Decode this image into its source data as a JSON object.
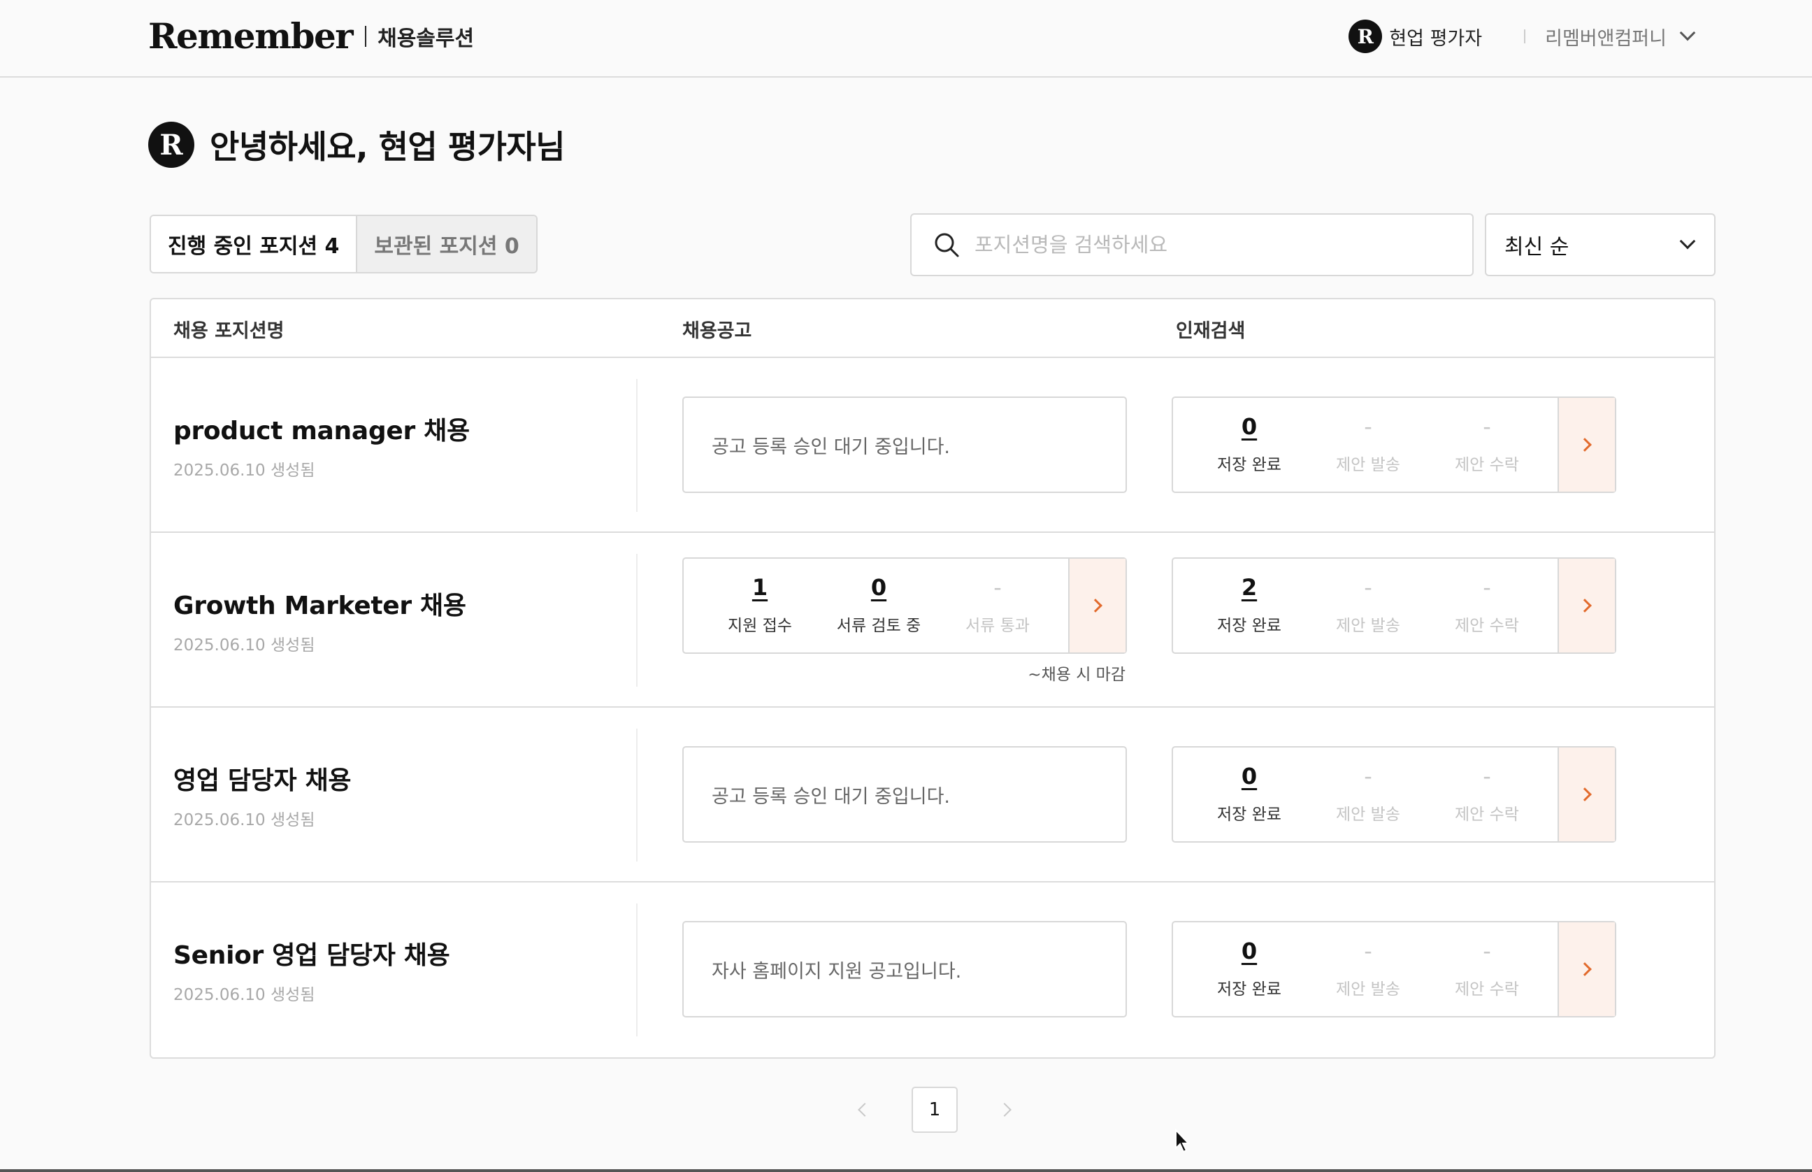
{
  "header": {
    "logo": "Remember",
    "product": "채용솔루션",
    "user_badge": "R",
    "user_name": "현업 평가자",
    "company": "리멤버앤컴퍼니"
  },
  "greeting": {
    "badge": "R",
    "text": "안녕하세요, 현업 평가자님"
  },
  "tabs": [
    {
      "label": "진행 중인 포지션 4",
      "active": true
    },
    {
      "label": "보관된 포지션 0",
      "active": false
    }
  ],
  "search": {
    "placeholder": "포지션명을 검색하세요"
  },
  "sort": {
    "selected": "최신 순"
  },
  "table": {
    "columns": [
      "채용 포지션명",
      "채용공고",
      "인재검색"
    ],
    "rows": [
      {
        "name": "product manager 채용",
        "created": "2025.06.10 생성됨",
        "posting_message": "공고 등록 승인 대기 중입니다.",
        "talent": [
          {
            "value": "0",
            "label": "저장 완료"
          },
          {
            "value": "-",
            "label": "제안 발송"
          },
          {
            "value": "-",
            "label": "제안 수락"
          }
        ]
      },
      {
        "name": "Growth Marketer 채용",
        "created": "2025.06.10 생성됨",
        "posting": [
          {
            "value": "1",
            "label": "지원 접수"
          },
          {
            "value": "0",
            "label": "서류 검토 중"
          },
          {
            "value": "-",
            "label": "서류 통과"
          }
        ],
        "deadline": "~채용 시 마감",
        "talent": [
          {
            "value": "2",
            "label": "저장 완료"
          },
          {
            "value": "-",
            "label": "제안 발송"
          },
          {
            "value": "-",
            "label": "제안 수락"
          }
        ]
      },
      {
        "name": "영업 담당자 채용",
        "created": "2025.06.10 생성됨",
        "posting_message": "공고 등록 승인 대기 중입니다.",
        "talent": [
          {
            "value": "0",
            "label": "저장 완료"
          },
          {
            "value": "-",
            "label": "제안 발송"
          },
          {
            "value": "-",
            "label": "제안 수락"
          }
        ]
      },
      {
        "name": "Senior 영업 담당자 채용",
        "created": "2025.06.10 생성됨",
        "posting_message": "자사 홈페이지 지원 공고입니다.",
        "talent": [
          {
            "value": "0",
            "label": "저장 완료"
          },
          {
            "value": "-",
            "label": "제안 발송"
          },
          {
            "value": "-",
            "label": "제안 수락"
          }
        ]
      }
    ]
  },
  "pagination": {
    "current": "1"
  },
  "colors": {
    "accent": "#e26a2c",
    "accent_bg": "#fdf1eb",
    "brand": "#111111"
  }
}
